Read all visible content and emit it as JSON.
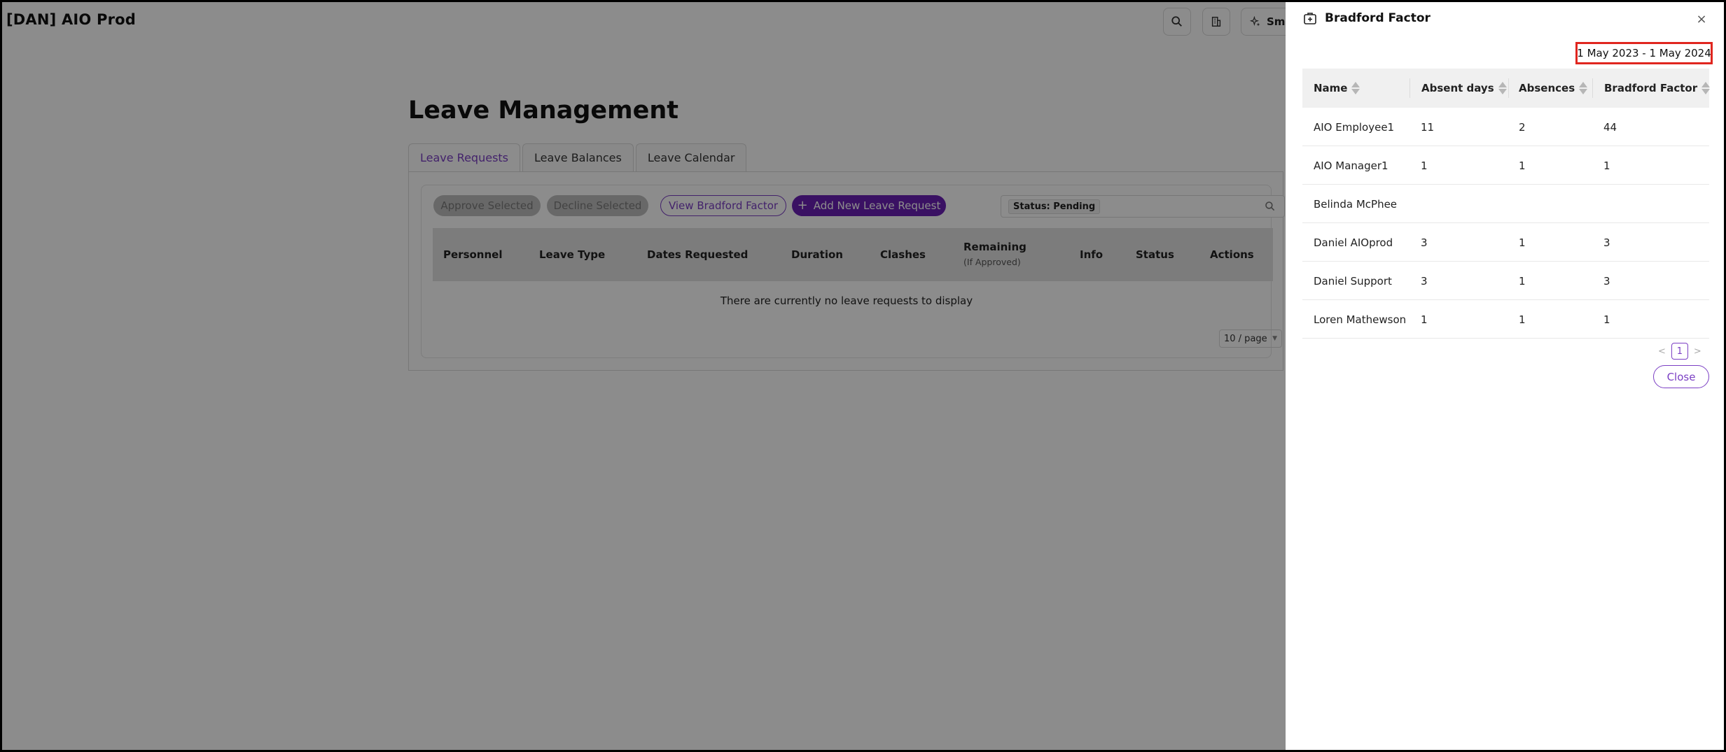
{
  "app": {
    "title": "[DAN] AIO Prod",
    "header_pill_label": "Sma"
  },
  "page": {
    "title": "Leave Management",
    "tabs": [
      {
        "label": "Leave Requests"
      },
      {
        "label": "Leave Balances"
      },
      {
        "label": "Leave Calendar"
      }
    ],
    "actions": {
      "approve": "Approve Selected",
      "decline": "Decline Selected",
      "view_bradford": "View Bradford Factor",
      "add_new": "Add New Leave Request"
    },
    "filter_tag": "Status: Pending",
    "columns": {
      "personnel": "Personnel",
      "leave_type": "Leave Type",
      "dates_requested": "Dates Requested",
      "duration": "Duration",
      "clashes": "Clashes",
      "remaining": "Remaining",
      "remaining_sub": "(If Approved)",
      "info": "Info",
      "status": "Status",
      "actions": "Actions"
    },
    "empty_message": "There are currently no leave requests to display",
    "page_size": "10 / page"
  },
  "drawer": {
    "title": "Bradford Factor",
    "close_icon": "×",
    "date_range": "1 May 2023 - 1 May 2024",
    "columns": {
      "name": "Name",
      "absent_days": "Absent days",
      "absences": "Absences",
      "bradford_factor": "Bradford Factor"
    },
    "rows": [
      {
        "name": "AIO Employee1",
        "absent_days": "11",
        "absences": "2",
        "bradford_factor": "44"
      },
      {
        "name": "AIO Manager1",
        "absent_days": "1",
        "absences": "1",
        "bradford_factor": "1"
      },
      {
        "name": "Belinda McPhee",
        "absent_days": "",
        "absences": "",
        "bradford_factor": ""
      },
      {
        "name": "Daniel AIOprod",
        "absent_days": "3",
        "absences": "1",
        "bradford_factor": "3"
      },
      {
        "name": "Daniel Support",
        "absent_days": "3",
        "absences": "1",
        "bradford_factor": "3"
      },
      {
        "name": "Loren Mathewson",
        "absent_days": "1",
        "absences": "1",
        "bradford_factor": "1"
      }
    ],
    "pagination": {
      "prev": "<",
      "current": "1",
      "next": ">"
    },
    "close_label": "Close"
  },
  "colors": {
    "accent": "#6a1fb4",
    "highlight_border": "#e0261f",
    "overlay": "rgba(0,0,0,0.45)"
  }
}
